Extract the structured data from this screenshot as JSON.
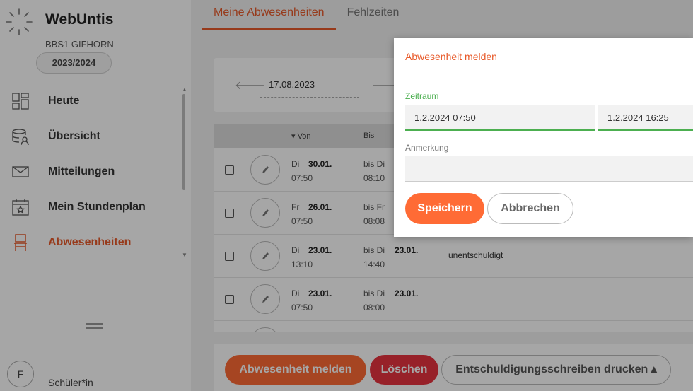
{
  "sidebar": {
    "app_title": "WebUntis",
    "school": "BBS1 GIFHORN",
    "year": "2023/2024",
    "items": [
      {
        "label": "Heute",
        "icon": "dashboard-icon"
      },
      {
        "label": "Übersicht",
        "icon": "overview-icon"
      },
      {
        "label": "Mitteilungen",
        "icon": "mail-icon"
      },
      {
        "label": "Mein Stundenplan",
        "icon": "calendar-icon"
      },
      {
        "label": "Abwesenheiten",
        "icon": "chair-icon",
        "active": true
      }
    ],
    "avatar_letter": "F",
    "role": "Schüler*in"
  },
  "tabs": [
    {
      "label": "Meine Abwesenheiten",
      "active": true
    },
    {
      "label": "Fehlzeiten"
    }
  ],
  "datebar": {
    "date": "17.08.2023"
  },
  "table": {
    "headers": {
      "von": "▾ Von",
      "bis": "Bis"
    },
    "rows": [
      {
        "von_day": "Di",
        "von_date": "30.01.",
        "von_time": "07:50",
        "bis_prefix": "bis Di",
        "bis_date": "",
        "bis_time": "08:10",
        "status": ""
      },
      {
        "von_day": "Fr",
        "von_date": "26.01.",
        "von_time": "07:50",
        "bis_prefix": "bis Fr",
        "bis_date": "",
        "bis_time": "08:08",
        "status": ""
      },
      {
        "von_day": "Di",
        "von_date": "23.01.",
        "von_time": "13:10",
        "bis_prefix": "bis Di",
        "bis_date": "23.01.",
        "bis_time": "14:40",
        "status": "unentschuldigt"
      },
      {
        "von_day": "Di",
        "von_date": "23.01.",
        "von_time": "07:50",
        "bis_prefix": "bis Di",
        "bis_date": "23.01.",
        "bis_time": "08:00",
        "status": ""
      }
    ]
  },
  "footer": {
    "melden_label": "Abwesenheit melden",
    "loeschen_label": "Löschen",
    "drucken_label": "Entschuldigungsschreiben drucken ▴"
  },
  "modal": {
    "title": "Abwesenheit melden",
    "zeitraum_label": "Zeitraum",
    "start_value": "1.2.2024 07:50",
    "end_value": "1.2.2024 16:25",
    "anmerkung_label": "Anmerkung",
    "anmerkung_value": "",
    "save_label": "Speichern",
    "cancel_label": "Abbrechen"
  },
  "colors": {
    "accent": "#e85a2a",
    "primary_button": "#ff6b35",
    "danger": "#e8333f",
    "focus_green": "#4caf50"
  }
}
